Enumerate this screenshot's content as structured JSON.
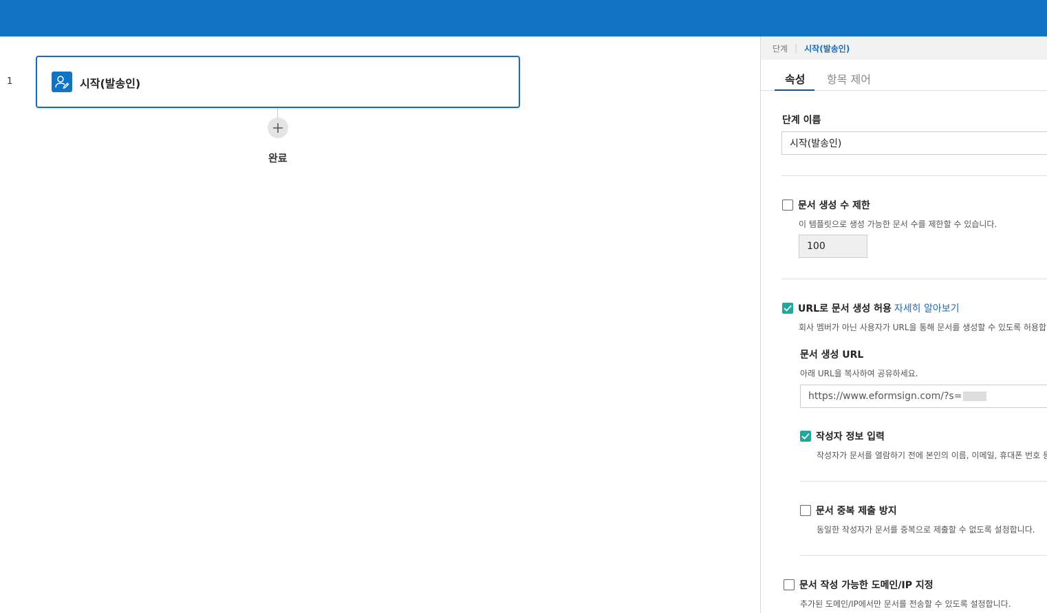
{
  "canvas": {
    "step_number": "1",
    "step_label": "시작(발송인)",
    "done_label": "완료"
  },
  "panel": {
    "breadcrumb": {
      "parent": "단계",
      "current": "시작(발송인)"
    },
    "tabs": [
      {
        "label": "속성"
      },
      {
        "label": "항목 제어"
      }
    ],
    "step_name": {
      "label": "단계 이름",
      "value": "시작(발송인)"
    },
    "doc_limit": {
      "label": "문서 생성 수 제한",
      "desc": "이 템플릿으로 생성 가능한 문서 수를 제한할 수 있습니다.",
      "value": "100",
      "checked": false
    },
    "url_create": {
      "label": "URL로 문서 생성 허용",
      "link": "자세히 알아보기",
      "desc": "회사 멤버가 아닌 사용자가 URL을 통해 문서를 생성할 수 있도록 허용합니다",
      "checked": true,
      "url_title": "문서 생성 URL",
      "url_desc": "아래 URL을 복사하여 공유하세요.",
      "url_value": "https://www.eformsign.com/?s="
    },
    "writer_info": {
      "label": "작성자 정보 입력",
      "desc": "작성자가 문서를 열람하기 전에 본인의 이름, 이메일, 휴대폰 번호 등을",
      "checked": true
    },
    "dup_prevent": {
      "label": "문서 중복 제출 방지",
      "desc": "동일한 작성자가 문서를 중복으로 제출할 수 없도록 설정합니다.",
      "checked": false
    },
    "domain_ip": {
      "label": "문서 작성 가능한 도메인/IP 지정",
      "desc": "추가된 도메인/IP에서만 문서를 전송할 수 있도록 설정합니다.",
      "checked": false
    }
  },
  "colors": {
    "header": "#1173c4",
    "accent": "#1a6bb5",
    "check": "#1ea99b"
  }
}
